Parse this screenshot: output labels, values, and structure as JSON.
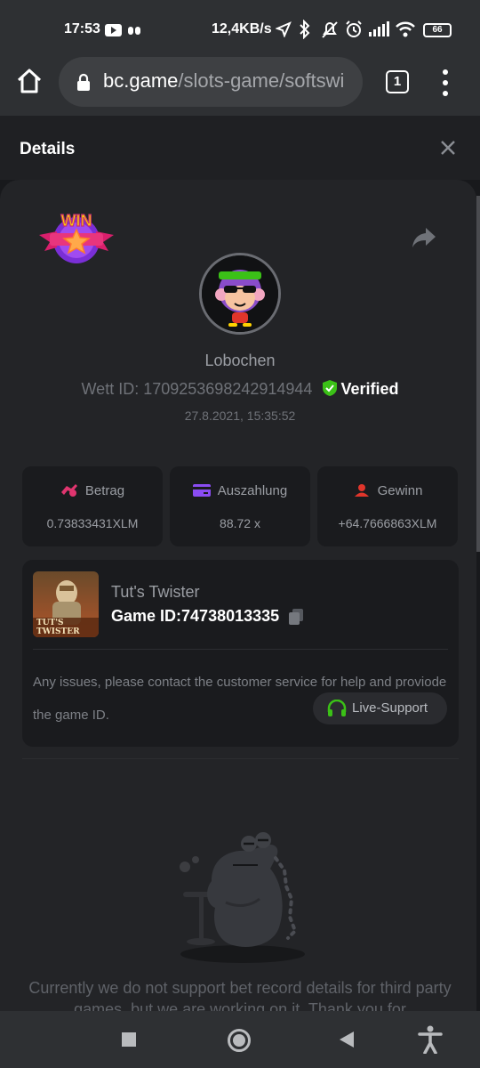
{
  "status_bar": {
    "time": "17:53",
    "network_speed": "12,4KB/s",
    "battery": "66"
  },
  "browser": {
    "url_domain": "bc.game",
    "url_path": "/slots-game/softswi",
    "tab_count": "1"
  },
  "details": {
    "title": "Details"
  },
  "bet": {
    "username": "Lobochen",
    "bet_id_label": "Wett ID:",
    "bet_id": "1709253698242914944",
    "verified_label": "Verified",
    "date": "27.8.2021, 15:35:52"
  },
  "stats": [
    {
      "label": "Betrag",
      "value": "0.73833431XLM",
      "icon": "bet-amount-icon",
      "color": "#e0356f"
    },
    {
      "label": "Auszahlung",
      "value": "88.72 x",
      "icon": "payout-card-icon",
      "color": "#8a4cf3"
    },
    {
      "label": "Gewinn",
      "value": "+64.7666863XLM",
      "icon": "profit-icon",
      "color": "#e0352b"
    }
  ],
  "game": {
    "name": "Tut's Twister",
    "id_label": "Game ID:",
    "id": "74738013335",
    "thumb_text": "TUT'S TWISTER",
    "issue_text": "Any issues, please contact the customer service for help and proviode the game ID.",
    "support_label": "Live-Support"
  },
  "empty_state": {
    "message": "Currently we do not support bet record details for third party games, but we are working on it. Thank you for"
  },
  "colors": {
    "accent_green": "#3bc117",
    "win_pink": "#d91f6c",
    "win_yellow": "#ffd200"
  }
}
